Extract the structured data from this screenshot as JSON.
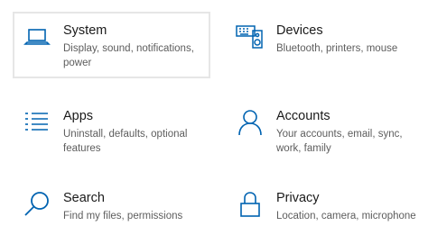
{
  "accent_color": "#0063b1",
  "tiles": [
    {
      "id": "system",
      "icon": "laptop-icon",
      "title": "System",
      "description": "Display, sound, notifications, power"
    },
    {
      "id": "devices",
      "icon": "devices-icon",
      "title": "Devices",
      "description": "Bluetooth, printers, mouse"
    },
    {
      "id": "apps",
      "icon": "apps-list-icon",
      "title": "Apps",
      "description": "Uninstall, defaults, optional features"
    },
    {
      "id": "accounts",
      "icon": "person-icon",
      "title": "Accounts",
      "description": "Your accounts, email, sync, work, family"
    },
    {
      "id": "search",
      "icon": "search-icon",
      "title": "Search",
      "description": "Find my files, permissions"
    },
    {
      "id": "privacy",
      "icon": "lock-icon",
      "title": "Privacy",
      "description": "Location, camera, microphone"
    }
  ]
}
